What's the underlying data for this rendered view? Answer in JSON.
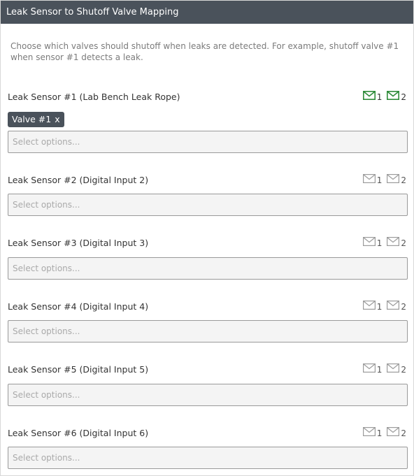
{
  "header": {
    "title": "Leak Sensor to Shutoff Valve Mapping"
  },
  "description": "Choose which valves should shutoff when leaks are detected. For example, shutoff valve #1 when sensor #1 detects a leak.",
  "select_placeholder": "Select options...",
  "colors": {
    "header_bg": "#4a525b",
    "active_icon": "#2e8b3a",
    "inactive_icon": "#9c9c9c"
  },
  "sensors": [
    {
      "label": "Leak Sensor #1 (Lab Bench Leak Rope)",
      "notify_1": "1",
      "notify_2": "2",
      "notify_active": true,
      "selected_tag": "Valve #1",
      "tag_remove": "x"
    },
    {
      "label": "Leak Sensor #2 (Digital Input 2)",
      "notify_1": "1",
      "notify_2": "2",
      "notify_active": false
    },
    {
      "label": "Leak Sensor #3 (Digital Input 3)",
      "notify_1": "1",
      "notify_2": "2",
      "notify_active": false
    },
    {
      "label": "Leak Sensor #4 (Digital Input 4)",
      "notify_1": "1",
      "notify_2": "2",
      "notify_active": false
    },
    {
      "label": "Leak Sensor #5 (Digital Input 5)",
      "notify_1": "1",
      "notify_2": "2",
      "notify_active": false
    },
    {
      "label": "Leak Sensor #6 (Digital Input 6)",
      "notify_1": "1",
      "notify_2": "2",
      "notify_active": false
    }
  ]
}
